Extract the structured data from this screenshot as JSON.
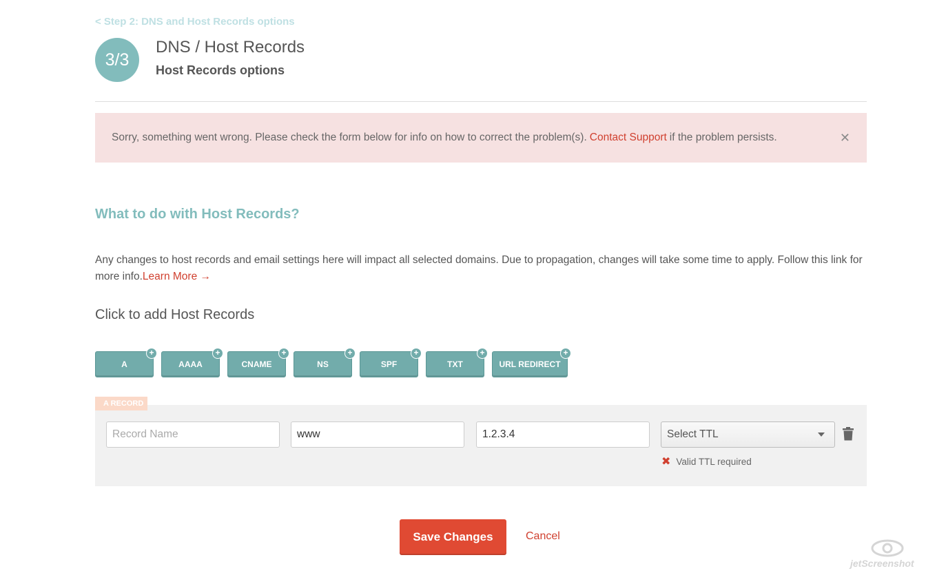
{
  "header": {
    "back_link": "< Step 2: DNS and Host Records options",
    "step_indicator": "3/3",
    "title": "DNS / Host Records",
    "subtitle": "Host Records options"
  },
  "alert": {
    "text_before": "Sorry, something went wrong. Please check the form below for info on how to correct the problem(s).",
    "link_label": "Contact Support",
    "text_after": "if the problem persists.",
    "close_symbol": "✕",
    "background_color": "#f6e1e1"
  },
  "section": {
    "heading": "What to do with Host Records?",
    "info_text": "Any changes to host records and email settings here will impact all selected domains. Due to propagation, changes will take some time to apply. Follow this link for more info.",
    "learn_more": "Learn More →",
    "add_label": "Click to add Host Records"
  },
  "record_types": [
    "A",
    "AAAA",
    "CNAME",
    "NS",
    "SPF",
    "TXT",
    "URL REDIRECT"
  ],
  "record": {
    "tag": "A RECORD",
    "name_placeholder": "Record Name",
    "name_value": "",
    "host_value": "www",
    "address_value": "1.2.3.4",
    "ttl_selected": "Select TTL",
    "ttl_error": "Valid TTL required"
  },
  "actions": {
    "save": "Save Changes",
    "cancel": "Cancel"
  },
  "watermark": {
    "text": "jetScreenshot"
  },
  "colors": {
    "accent_teal": "#82bcbc",
    "button_teal": "#72acab",
    "danger": "#e04a33",
    "link_red": "#d0402f"
  }
}
